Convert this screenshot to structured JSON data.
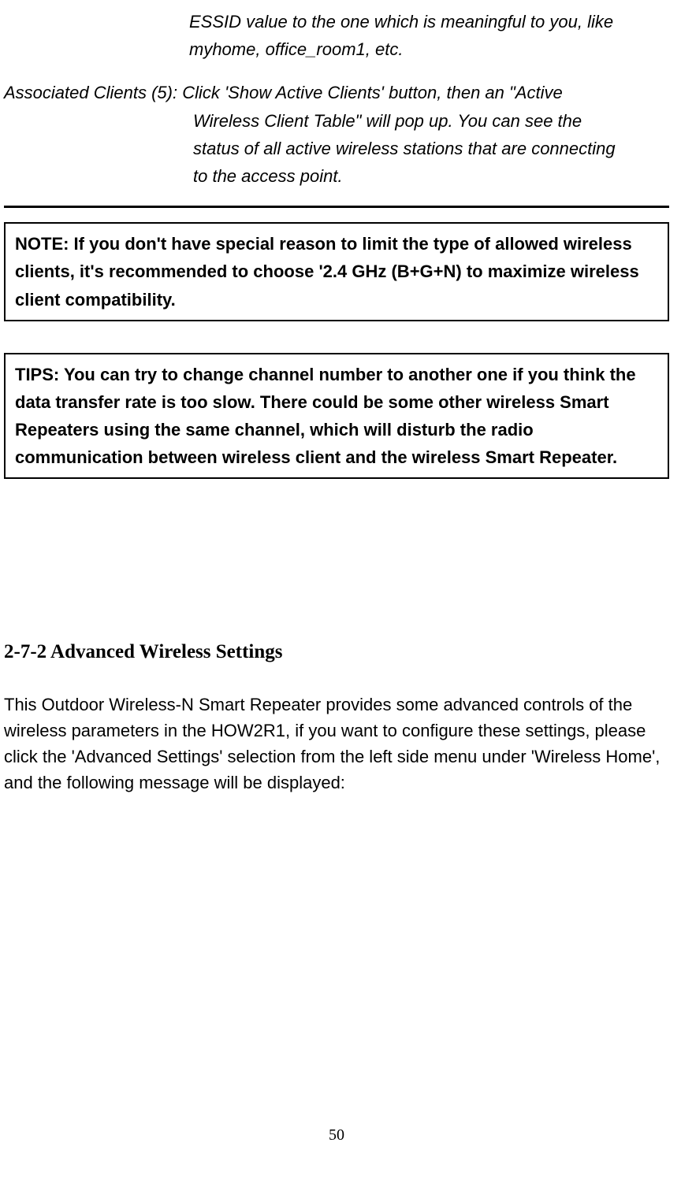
{
  "essid": {
    "line1": "ESSID value to the one which is meaningful to you, like",
    "line2": "myhome, office_room1, etc."
  },
  "associatedClients": {
    "label": "Associated Clients (5):",
    "line1": " Click 'Show Active Clients' button, then an \"Active",
    "line2": "Wireless Client Table\" will pop up. You can see the",
    "line3": "status of all active wireless stations that are connecting",
    "line4": "to the access point."
  },
  "note": "NOTE: If you don't have special reason to limit the type of allowed wireless clients, it's recommended to choose '2.4 GHz (B+G+N) to maximize wireless client compatibility.",
  "tips": "TIPS: You can try to change channel number to another one if you think the data transfer rate is too slow. There could be some other wireless Smart Repeaters using the same channel, which will disturb the radio communication between wireless client and the wireless Smart Repeater.",
  "sectionHeading": "2-7-2 Advanced Wireless Settings",
  "bodyParagraph": "This Outdoor Wireless-N Smart Repeater provides some advanced controls of the wireless parameters in the HOW2R1, if you want to configure these settings, please click the 'Advanced Settings' selection from the left side menu under 'Wireless Home', and the following message will be displayed:",
  "pageNumber": "50"
}
